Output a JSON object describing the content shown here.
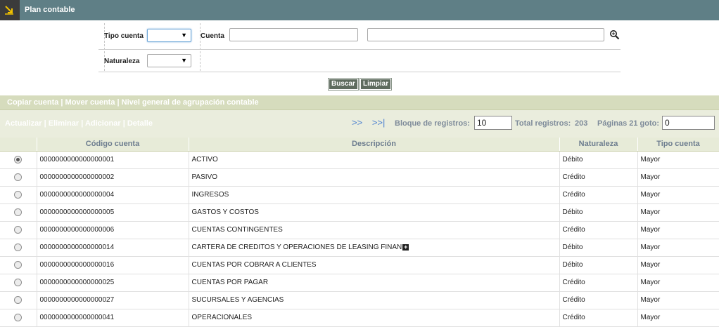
{
  "header": {
    "title": "Plan contable",
    "icon": "arrow-down-right-icon"
  },
  "filters": {
    "tipo_cuenta_label": "Tipo cuenta",
    "tipo_cuenta_value": "",
    "cuenta_label": "Cuenta",
    "cuenta_code_value": "",
    "cuenta_desc_value": "",
    "naturaleza_label": "Naturaleza",
    "naturaleza_value": ""
  },
  "buttons": {
    "buscar": "Buscar",
    "limpiar": "Limpiar"
  },
  "top_actions": "Copiar cuenta | Mover cuenta | Nivel general de agrupación contable",
  "row_actions": "Actualizar | Eliminar | Adicionar | Detalle",
  "pagination": {
    "next": ">>",
    "last": ">>|",
    "block_label": "Bloque de registros:",
    "block_value": "10",
    "total_label": "Total registros:",
    "total_value": "203",
    "pages_label": "Páginas 21 goto:",
    "goto_value": "0"
  },
  "table": {
    "headers": [
      "",
      "Código cuenta",
      "Descripción",
      "Naturaleza",
      "Tipo cuenta"
    ],
    "rows": [
      {
        "selected": true,
        "codigo": "0000000000000000001",
        "descripcion": "ACTIVO",
        "naturaleza": "Débito",
        "tipo": "Mayor"
      },
      {
        "selected": false,
        "codigo": "0000000000000000002",
        "descripcion": "PASIVO",
        "naturaleza": "Crédito",
        "tipo": "Mayor"
      },
      {
        "selected": false,
        "codigo": "0000000000000000004",
        "descripcion": "INGRESOS",
        "naturaleza": "Crédito",
        "tipo": "Mayor"
      },
      {
        "selected": false,
        "codigo": "0000000000000000005",
        "descripcion": "GASTOS Y COSTOS",
        "naturaleza": "Débito",
        "tipo": "Mayor"
      },
      {
        "selected": false,
        "codigo": "0000000000000000006",
        "descripcion": "CUENTAS CONTINGENTES",
        "naturaleza": "Crédito",
        "tipo": "Mayor"
      },
      {
        "selected": false,
        "codigo": "0000000000000000014",
        "descripcion": "CARTERA DE CREDITOS Y OPERACIONES DE LEASING FINAN",
        "naturaleza": "Débito",
        "tipo": "Mayor",
        "expand": true
      },
      {
        "selected": false,
        "codigo": "0000000000000000016",
        "descripcion": "CUENTAS POR COBRAR A CLIENTES",
        "naturaleza": "Débito",
        "tipo": "Mayor"
      },
      {
        "selected": false,
        "codigo": "0000000000000000025",
        "descripcion": "CUENTAS POR PAGAR",
        "naturaleza": "Crédito",
        "tipo": "Mayor"
      },
      {
        "selected": false,
        "codigo": "0000000000000000027",
        "descripcion": "SUCURSALES Y AGENCIAS",
        "naturaleza": "Crédito",
        "tipo": "Mayor"
      },
      {
        "selected": false,
        "codigo": "0000000000000000041",
        "descripcion": "OPERACIONALES",
        "naturaleza": "Crédito",
        "tipo": "Mayor"
      }
    ]
  },
  "colors": {
    "titlebar": "#5f7f86",
    "band_top": "#d6dcbd",
    "band_second": "#eaeddd",
    "link_blue": "#4a7fd0"
  }
}
